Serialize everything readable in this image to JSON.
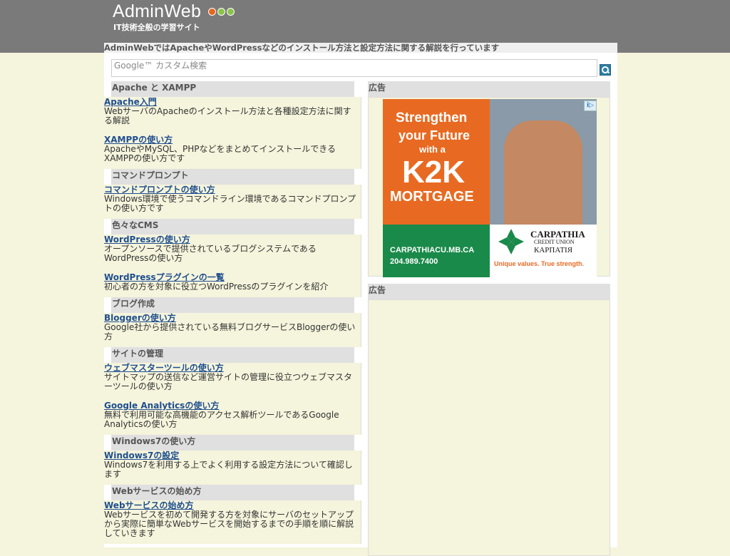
{
  "header": {
    "logo": "AdminWeb",
    "tagline": "IT技術全般の学習サイト",
    "dot_colors": [
      "#e8661e",
      "#8bc34a",
      "#8bc34a"
    ]
  },
  "description": "AdminWebではApacheやWordPressなどのインストール方法と設定方法に関する解説を行っています",
  "search": {
    "placeholder": "Google™ カスタム検索"
  },
  "categories": [
    {
      "title": "Apache と XAMPP",
      "entries": [
        {
          "link": "Apache入門",
          "desc": "WebサーバのApacheのインストール方法と各種設定方法に関する解説"
        },
        {
          "link": "XAMPPの使い方",
          "desc": "ApacheやMySQL、PHPなどをまとめてインストールできるXAMPPの使い方です"
        }
      ]
    },
    {
      "title": "コマンドプロンプト",
      "entries": [
        {
          "link": "コマンドプロンプトの使い方",
          "desc": "Windows環境で使うコマンドライン環境であるコマンドプロンプトの使い方です"
        }
      ]
    },
    {
      "title": "色々なCMS",
      "entries": [
        {
          "link": "WordPressの使い方",
          "desc": "オープンソースで提供されているブログシステムであるWordPressの使い方"
        },
        {
          "link": "WordPressプラグインの一覧",
          "desc": "初心者の方を対象に役立つWordPressのプラグインを紹介"
        }
      ]
    },
    {
      "title": "ブログ作成",
      "entries": [
        {
          "link": "Bloggerの使い方",
          "desc": "Google社から提供されている無料ブログサービスBloggerの使い方"
        }
      ]
    },
    {
      "title": "サイトの管理",
      "entries": [
        {
          "link": "ウェブマスターツールの使い方",
          "desc": "サイトマップの送信など運営サイトの管理に役立つウェブマスターツールの使い方"
        },
        {
          "link": "Google Analyticsの使い方",
          "desc": "無料で利用可能な高機能のアクセス解析ツールであるGoogle Analyticsの使い方"
        }
      ]
    },
    {
      "title": "Windows7の使い方",
      "entries": [
        {
          "link": "Windows7の設定",
          "desc": "Windows7を利用する上でよく利用する設定方法について確認します"
        }
      ]
    },
    {
      "title": "Webサービスの始め方",
      "entries": [
        {
          "link": "Webサービスの始め方",
          "desc": "Webサービスを初めて開発する方を対象にサーバのセットアップから実際に簡単なWebサービスを開始するまでの手順を順に解説していきます"
        }
      ]
    }
  ],
  "ads": {
    "label1": "広告",
    "label2": "広告",
    "banner": {
      "line1": "Strengthen",
      "line2": "your Future",
      "line3": "with a",
      "line4": "K2K",
      "line5": "MORTGAGE",
      "url": "CARPATHIACU.MB.CA",
      "phone": "204.989.7400",
      "brand": "CARPATHIA",
      "brand_sub": "CREDIT UNION",
      "brand_cyr": "КАРПАТІЯ",
      "slogan": "Unique values. True strength.",
      "info_badge": "i▷"
    }
  }
}
